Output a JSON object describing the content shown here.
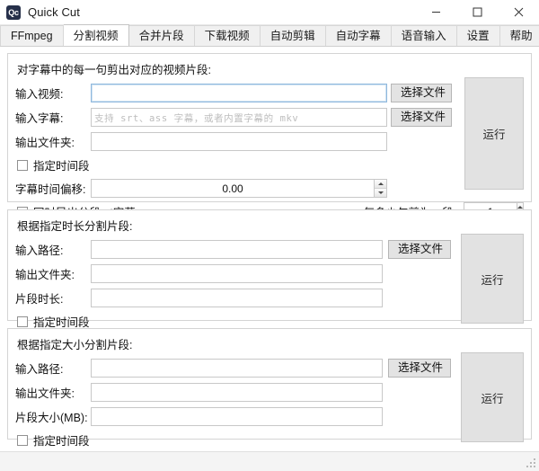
{
  "window": {
    "icon_text": "Qc",
    "title": "Quick Cut",
    "minimize_icon": "minimize-icon",
    "maximize_icon": "maximize-icon",
    "close_icon": "close-icon"
  },
  "tabs": [
    {
      "label": "FFmpeg",
      "active": false
    },
    {
      "label": "分割视频",
      "active": true
    },
    {
      "label": "合并片段",
      "active": false
    },
    {
      "label": "下载视频",
      "active": false
    },
    {
      "label": "自动剪辑",
      "active": false
    },
    {
      "label": "自动字幕",
      "active": false
    },
    {
      "label": "语音输入",
      "active": false
    },
    {
      "label": "设置",
      "active": false
    },
    {
      "label": "帮助",
      "active": false
    }
  ],
  "groups": [
    {
      "title": "对字幕中的每一句剪出对应的视频片段:",
      "rows": {
        "input_video_label": "输入视频:",
        "input_video_value": "",
        "input_video_browse": "选择文件",
        "input_subtitle_label": "输入字幕:",
        "input_subtitle_value": "",
        "input_subtitle_placeholder": "支持 srt、ass 字幕，或者内置字幕的 mkv",
        "input_subtitle_browse": "选择文件",
        "output_folder_label": "输出文件夹:",
        "output_folder_value": "",
        "time_range_checkbox": "指定时间段",
        "time_range_checked": false,
        "offset_label": "字幕时间偏移:",
        "offset_value": "0.00",
        "export_srt_checkbox": "同时导出分段srt字幕",
        "export_srt_checked": true,
        "sentences_label": "每多少句剪为一段:",
        "sentences_value": "1"
      },
      "run_label": "运行"
    },
    {
      "title": "根据指定时长分割片段:",
      "rows": {
        "input_path_label": "输入路径:",
        "input_path_value": "",
        "input_path_browse": "选择文件",
        "output_folder_label": "输出文件夹:",
        "output_folder_value": "",
        "duration_label": "片段时长:",
        "duration_value": "",
        "time_range_checkbox": "指定时间段",
        "time_range_checked": false
      },
      "run_label": "运行"
    },
    {
      "title": "根据指定大小分割片段:",
      "rows": {
        "input_path_label": "输入路径:",
        "input_path_value": "",
        "input_path_browse": "选择文件",
        "output_folder_label": "输出文件夹:",
        "output_folder_value": "",
        "size_label": "片段大小(MB):",
        "size_value": "",
        "time_range_checkbox": "指定时间段",
        "time_range_checked": false
      },
      "run_label": "运行"
    }
  ],
  "colors": {
    "accent_focus": "#8fb8dd",
    "app_icon_bg": "#26304a",
    "button_face": "#e3e3e3",
    "run_button_face": "#e2e2e2"
  }
}
